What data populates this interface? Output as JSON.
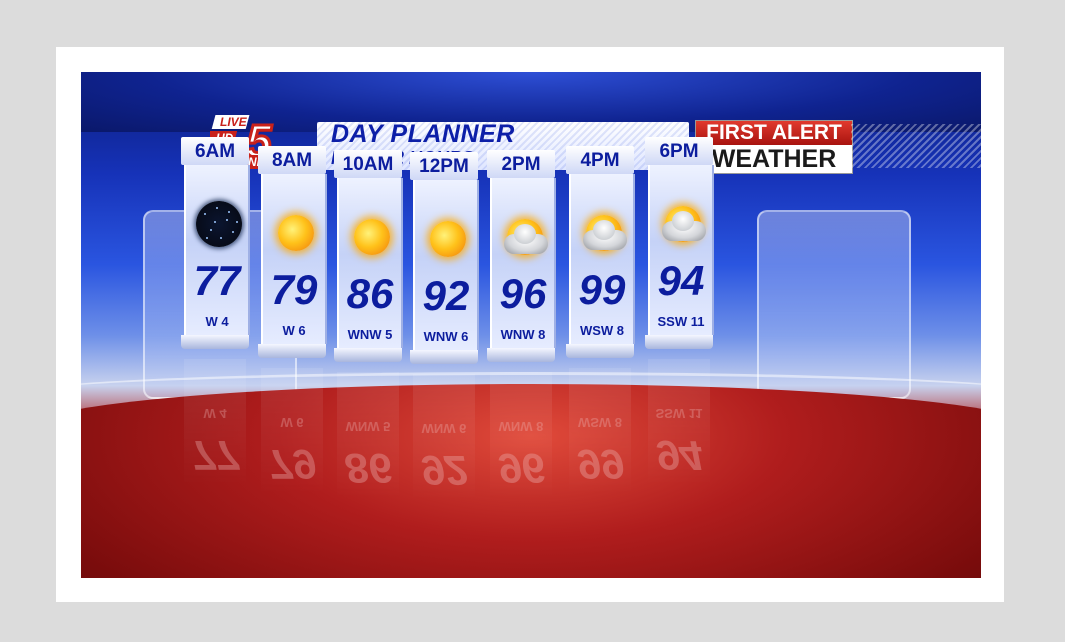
{
  "header": {
    "logo": {
      "live": "LIVE",
      "hd": "HD",
      "channel": "5",
      "news": "NEWS"
    },
    "title": "DAY PLANNER",
    "subtitle": "NEXT 12 HOURS",
    "brand_top": "FIRST ALERT",
    "brand_bottom": "WEATHER"
  },
  "forecast": [
    {
      "time": "6AM",
      "temp": "77",
      "wind": "W 4",
      "icon": "night-clear-icon"
    },
    {
      "time": "8AM",
      "temp": "79",
      "wind": "W 6",
      "icon": "sunny-icon"
    },
    {
      "time": "10AM",
      "temp": "86",
      "wind": "WNW 5",
      "icon": "sunny-icon"
    },
    {
      "time": "12PM",
      "temp": "92",
      "wind": "WNW 6",
      "icon": "sunny-icon"
    },
    {
      "time": "2PM",
      "temp": "96",
      "wind": "WNW 8",
      "icon": "partly-cloudy-icon"
    },
    {
      "time": "4PM",
      "temp": "99",
      "wind": "WSW 8",
      "icon": "partly-cloudy-icon"
    },
    {
      "time": "6PM",
      "temp": "94",
      "wind": "SSW 11",
      "icon": "partly-cloudy-icon"
    }
  ],
  "colors": {
    "primary_blue": "#0c1d9e",
    "alert_red": "#c8211a",
    "floor_red": "#b01d1d"
  }
}
